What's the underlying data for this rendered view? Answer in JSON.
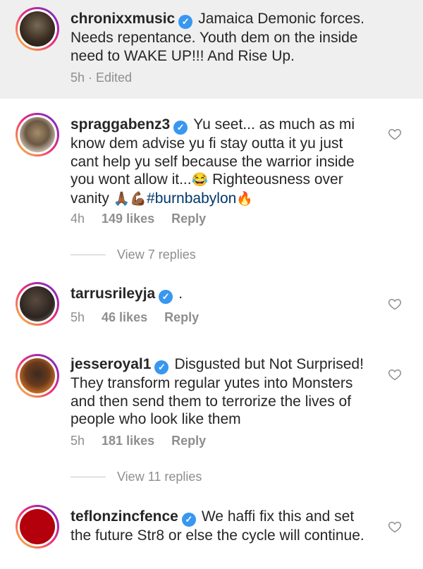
{
  "comments": [
    {
      "username": "chronixxmusic",
      "text": "Jamaica Demonic forces. Needs repentance. Youth dem on the inside need to WAKE UP!!! And Rise Up.",
      "time": "5h · Edited"
    },
    {
      "username": "spraggabenz3",
      "text_part1": "Yu seet... as much as mi know dem advise yu fi stay outta it yu just cant help yu self because the warrior inside you wont allow it...",
      "emoji1": "😂",
      "text_part2": "Righteousness over vanity",
      "emoji2": "🙏🏾💪🏾",
      "hashtag": "#burnbabylon",
      "emoji3": "🔥",
      "time": "4h",
      "likes": "149 likes",
      "reply": "Reply",
      "view_replies": "View 7 replies"
    },
    {
      "username": "tarrusrileyja",
      "text": ".",
      "time": "5h",
      "likes": "46 likes",
      "reply": "Reply"
    },
    {
      "username": "jesseroyal1",
      "text": "Disgusted but Not Surprised! They transform regular yutes into Monsters and then send them to terrorize the lives of people who look like them",
      "time": "5h",
      "likes": "181 likes",
      "reply": "Reply",
      "view_replies": "View 11 replies"
    },
    {
      "username": "teflonzincfence",
      "text": "We haffi fix this and set the future Str8 or else the cycle will continue."
    }
  ],
  "icons": {
    "verified": "verified-badge-icon",
    "like": "heart-outline-icon"
  },
  "colors": {
    "verified": "#3897f0",
    "hashtag": "#00376b",
    "meta": "#8e8e8e",
    "highlight_bg": "#efefef"
  }
}
